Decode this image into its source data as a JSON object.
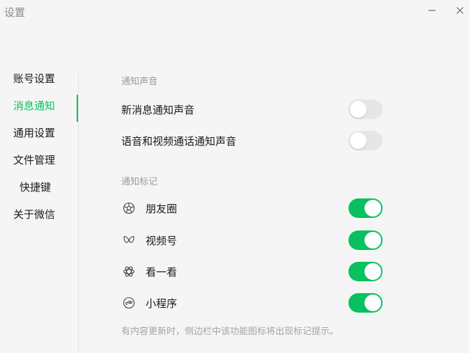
{
  "window": {
    "title": "设置",
    "minimize_glyph": "—",
    "close_glyph": "✕"
  },
  "sidebar": {
    "items": [
      {
        "label": "账号设置",
        "active": false
      },
      {
        "label": "消息通知",
        "active": true
      },
      {
        "label": "通用设置",
        "active": false
      },
      {
        "label": "文件管理",
        "active": false
      },
      {
        "label": "快捷键",
        "active": false
      },
      {
        "label": "关于微信",
        "active": false
      }
    ]
  },
  "notification_sound": {
    "section_title": "通知声音",
    "items": [
      {
        "label": "新消息通知声音",
        "enabled": false
      },
      {
        "label": "语音和视频通话通知声音",
        "enabled": false
      }
    ]
  },
  "notification_badge": {
    "section_title": "通知标记",
    "items": [
      {
        "label": "朋友圈",
        "icon": "moments-icon",
        "enabled": true
      },
      {
        "label": "视频号",
        "icon": "channels-icon",
        "enabled": true
      },
      {
        "label": "看一看",
        "icon": "top-stories-icon",
        "enabled": true
      },
      {
        "label": "小程序",
        "icon": "mini-programs-icon",
        "enabled": true
      }
    ],
    "hint": "有内容更新时，侧边栏中该功能图标将出现标记提示。"
  },
  "colors": {
    "accent": "#07c160",
    "background": "#f5f5f5",
    "toggle_off": "#e6e6e6",
    "muted_text": "#9a9a9a"
  }
}
